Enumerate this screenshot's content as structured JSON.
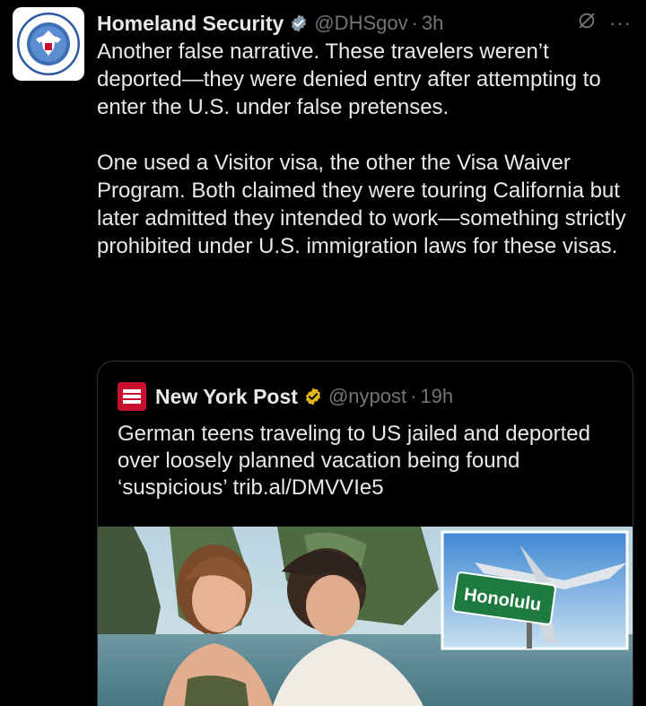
{
  "tweet": {
    "author_name": "Homeland Security",
    "handle": "@DHSgov",
    "separator": "·",
    "time": "3h",
    "paragraphs": [
      "Another false narrative. These travelers weren’t deported—they were denied entry after attempting to enter the U.S. under false pretenses.",
      "One used a Visitor visa, the other the Visa Waiver Program. Both claimed they were touring California but later admitted they intended to work—something strictly prohibited under U.S. immigration laws for these visas."
    ],
    "more_label": "···"
  },
  "quoted": {
    "author_name": "New York Post",
    "handle": "@nypost",
    "separator": "·",
    "time": "19h",
    "text": "German teens traveling to US jailed and deported over loosely planned vacation being found ‘suspicious’ trib.al/DMVVIe5",
    "logo_text": "NEW YORK POST",
    "inset_sign": "Honolulu"
  },
  "colors": {
    "background": "#000000",
    "text": "#e7e9ea",
    "secondary": "#71767b",
    "verified_blue": "#1d9bf0",
    "verified_gold": "#e2b719",
    "nyp_red": "#c8102e",
    "border": "#2f3336"
  }
}
